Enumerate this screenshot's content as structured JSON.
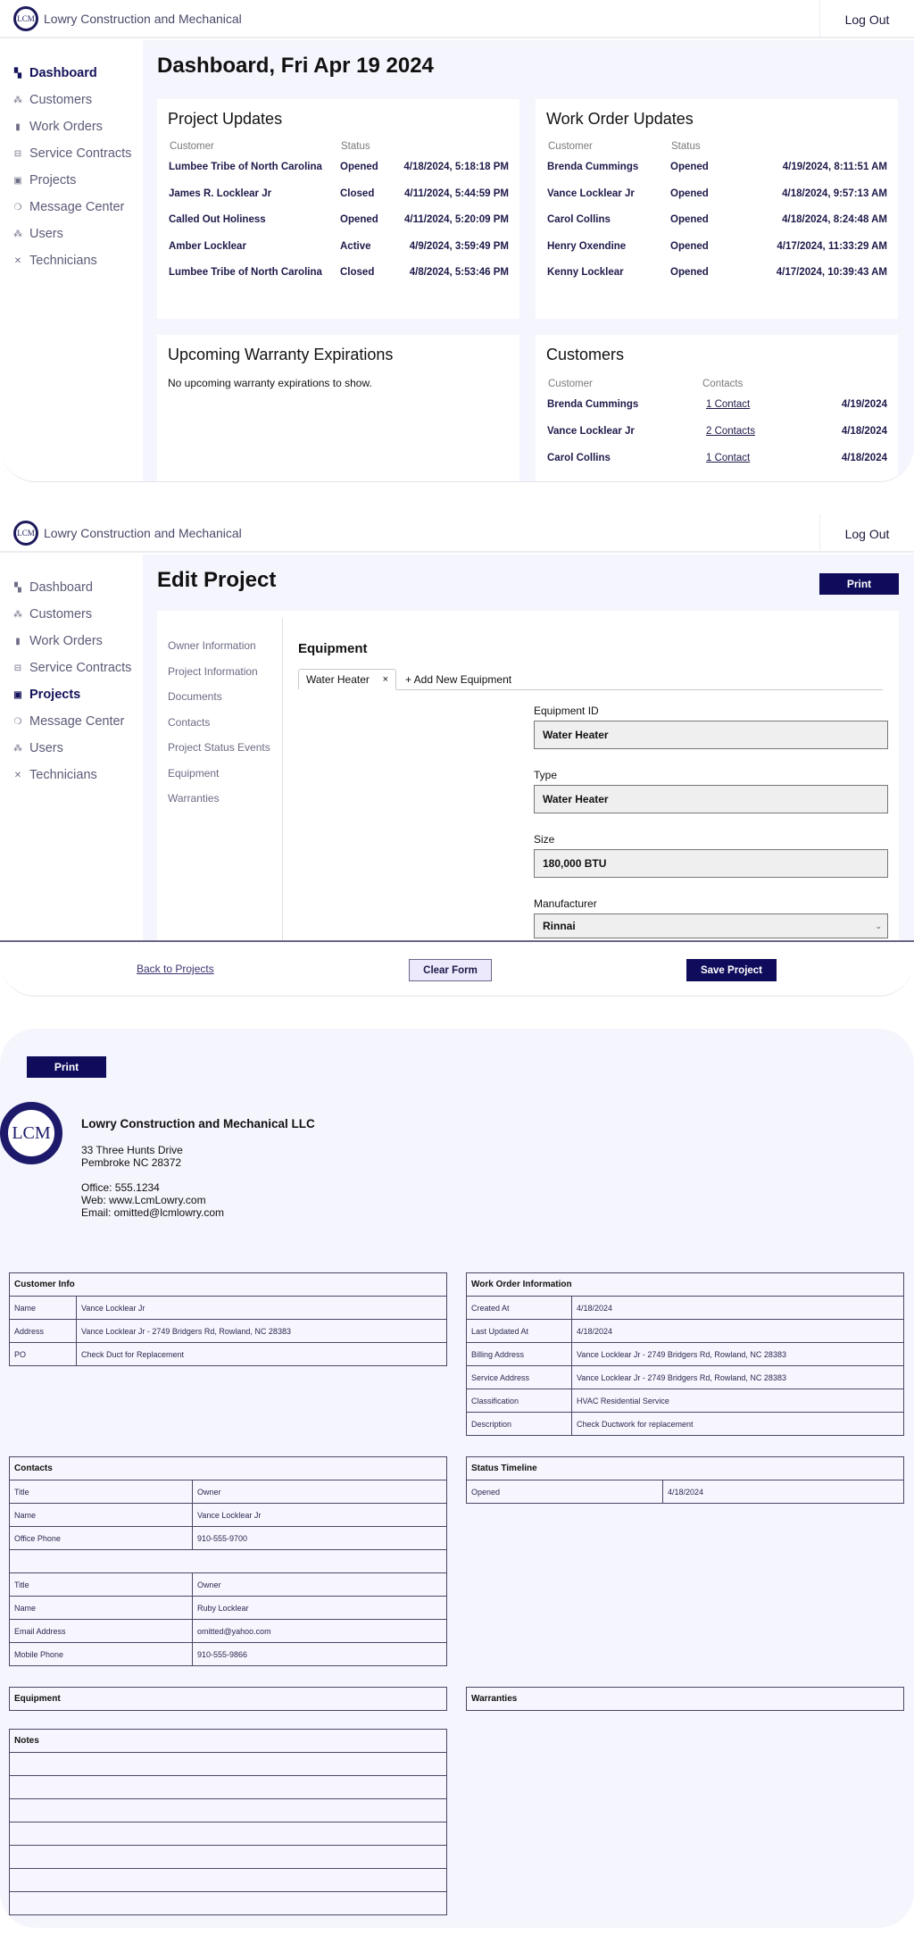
{
  "app": {
    "brand": "Lowry Construction and Mechanical",
    "logo_text": "LCM",
    "logout_label": "Log Out"
  },
  "sidebar": {
    "items": [
      {
        "label": "Dashboard",
        "icon": "dashboard-icon",
        "glyph": "▚"
      },
      {
        "label": "Customers",
        "icon": "customers-icon",
        "glyph": "⁂"
      },
      {
        "label": "Work Orders",
        "icon": "document-icon",
        "glyph": "▮"
      },
      {
        "label": "Service Contracts",
        "icon": "contract-icon",
        "glyph": "⊟"
      },
      {
        "label": "Projects",
        "icon": "projects-icon",
        "glyph": "▣"
      },
      {
        "label": "Message Center",
        "icon": "chat-icon",
        "glyph": "❍"
      },
      {
        "label": "Users",
        "icon": "users-icon",
        "glyph": "⁂"
      },
      {
        "label": "Technicians",
        "icon": "tools-icon",
        "glyph": "✕"
      }
    ]
  },
  "dashboard": {
    "title": "Dashboard, Fri Apr 19 2024",
    "active_nav": "Dashboard",
    "project_updates": {
      "title": "Project Updates",
      "columns": [
        "Customer",
        "Status",
        ""
      ],
      "rows": [
        {
          "customer": "Lumbee Tribe of North Carolina",
          "status": "Opened",
          "time": "4/18/2024, 5:18:18 PM"
        },
        {
          "customer": "James R. Locklear Jr",
          "status": "Closed",
          "time": "4/11/2024, 5:44:59 PM"
        },
        {
          "customer": "Called Out Holiness",
          "status": "Opened",
          "time": "4/11/2024, 5:20:09 PM"
        },
        {
          "customer": "Amber Locklear",
          "status": "Active",
          "time": "4/9/2024, 3:59:49 PM"
        },
        {
          "customer": "Lumbee Tribe of North Carolina",
          "status": "Closed",
          "time": "4/8/2024, 5:53:46 PM"
        }
      ]
    },
    "work_order_updates": {
      "title": "Work Order Updates",
      "columns": [
        "Customer",
        "Status",
        ""
      ],
      "rows": [
        {
          "customer": "Brenda Cummings",
          "status": "Opened",
          "time": "4/19/2024, 8:11:51 AM"
        },
        {
          "customer": "Vance Locklear Jr",
          "status": "Opened",
          "time": "4/18/2024, 9:57:13 AM"
        },
        {
          "customer": "Carol Collins",
          "status": "Opened",
          "time": "4/18/2024, 8:24:48 AM"
        },
        {
          "customer": "Henry Oxendine",
          "status": "Opened",
          "time": "4/17/2024, 11:33:29 AM"
        },
        {
          "customer": "Kenny Locklear",
          "status": "Opened",
          "time": "4/17/2024, 10:39:43 AM"
        }
      ]
    },
    "warranty": {
      "title": "Upcoming Warranty Expirations",
      "empty_text": "No upcoming warranty expirations to show."
    },
    "customers": {
      "title": "Customers",
      "columns": [
        "Customer",
        "Contacts",
        ""
      ],
      "rows": [
        {
          "customer": "Brenda Cummings",
          "contacts": "1 Contact",
          "date": "4/19/2024"
        },
        {
          "customer": "Vance Locklear Jr",
          "contacts": "2 Contacts",
          "date": "4/18/2024"
        },
        {
          "customer": "Carol Collins",
          "contacts": "1 Contact",
          "date": "4/18/2024"
        }
      ]
    }
  },
  "edit_project": {
    "title": "Edit Project",
    "active_nav": "Projects",
    "print_label": "Print",
    "subnav": [
      "Owner Information",
      "Project Information",
      "Documents",
      "Contacts",
      "Project Status Events",
      "Equipment",
      "Warranties"
    ],
    "section_title": "Equipment",
    "tabs": [
      {
        "label": "Water Heater",
        "close": "×"
      },
      {
        "label": "+ Add New Equipment"
      }
    ],
    "fields": [
      {
        "label": "Equipment ID",
        "value": "Water Heater"
      },
      {
        "label": "Type",
        "value": "Water Heater"
      },
      {
        "label": "Size",
        "value": "180,000 BTU"
      },
      {
        "label": "Manufacturer",
        "value": "Rinnai",
        "type": "select"
      }
    ],
    "actions": {
      "back": "Back to Projects",
      "clear": "Clear Form",
      "save": "Save Project"
    }
  },
  "print_view": {
    "print_label": "Print",
    "company": {
      "name": "Lowry Construction and Mechanical LLC",
      "address1": "33 Three Hunts Drive",
      "address2": "Pembroke NC 28372",
      "office": "Office: 555.1234",
      "web": "Web: www.LcmLowry.com",
      "email": "Email: omitted@lcmlowry.com"
    },
    "customer_info": {
      "title": "Customer Info",
      "rows": [
        [
          "Name",
          "Vance Locklear Jr"
        ],
        [
          "Address",
          "Vance Locklear Jr - 2749 Bridgers Rd, Rowland, NC 28383"
        ],
        [
          "PO",
          "Check Duct for Replacement"
        ]
      ]
    },
    "work_order_info": {
      "title": "Work Order Information",
      "rows": [
        [
          "Created At",
          "4/18/2024"
        ],
        [
          "Last Updated At",
          "4/18/2024"
        ],
        [
          "Billing Address",
          "Vance Locklear Jr - 2749 Bridgers Rd, Rowland, NC 28383"
        ],
        [
          "Service Address",
          "Vance Locklear Jr - 2749 Bridgers Rd, Rowland, NC 28383"
        ],
        [
          "Classification",
          "HVAC Residential Service"
        ],
        [
          "Description",
          "Check Ductwork for replacement"
        ]
      ]
    },
    "contacts": {
      "title": "Contacts",
      "rows": [
        [
          "Title",
          "Owner"
        ],
        [
          "Name",
          "Vance Locklear Jr"
        ],
        [
          "Office Phone",
          "910-555-9700"
        ],
        [
          "",
          ""
        ],
        [
          "Title",
          "Owner"
        ],
        [
          "Name",
          "Ruby Locklear"
        ],
        [
          "Email Address",
          "omitted@yahoo.com"
        ],
        [
          "Mobile Phone",
          "910-555-9866"
        ]
      ]
    },
    "status_timeline": {
      "title": "Status Timeline",
      "rows": [
        [
          "Opened",
          "4/18/2024"
        ]
      ]
    },
    "equipment": {
      "title": "Equipment"
    },
    "warranties": {
      "title": "Warranties"
    },
    "notes": {
      "title": "Notes",
      "empty_rows": 7
    }
  }
}
